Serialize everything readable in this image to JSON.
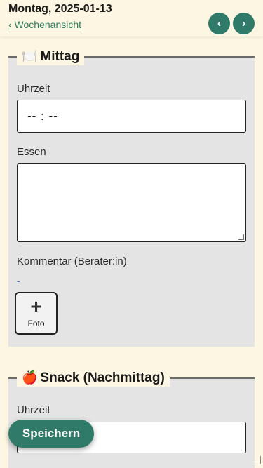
{
  "header": {
    "date": "Montag, 2025-01-13",
    "back_link": "‹ Wochenansicht",
    "prev_icon": "‹",
    "next_icon": "›"
  },
  "sections": [
    {
      "emoji": "🍽️",
      "title": "Mittag",
      "time_label": "Uhrzeit",
      "time_value": "-- : --",
      "food_label": "Essen",
      "food_value": "",
      "comment_label": "Kommentar (Berater:in)",
      "comment_value": "-",
      "photo_plus": "+",
      "photo_label": "Foto"
    },
    {
      "emoji": "🍎",
      "title": "Snack (Nachmittag)",
      "time_label": "Uhrzeit"
    }
  ],
  "save_button": "Speichern",
  "colors": {
    "accent": "#2f7a68",
    "link": "#2e7d5b",
    "background": "#fdf6e3",
    "section_bg": "#e4e4e4"
  }
}
